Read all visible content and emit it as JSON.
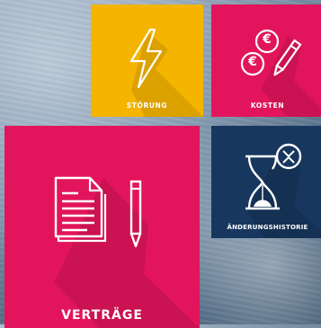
{
  "tiles": {
    "stoerung": {
      "label": "STÖRUNG",
      "icon": "lightning-bolt-icon",
      "color": "#f4b400"
    },
    "kosten": {
      "label": "KOSTEN",
      "icon": "euro-coins-pen-icon",
      "color": "#e2155c",
      "coin_symbol": "€"
    },
    "vertraege": {
      "label": "VERTRÄGE",
      "icon": "document-pen-icon",
      "color": "#e2155c"
    },
    "historie": {
      "label": "ÄNDERUNGSHISTORIE",
      "icon": "hourglass-icon",
      "color": "#17375f"
    }
  }
}
